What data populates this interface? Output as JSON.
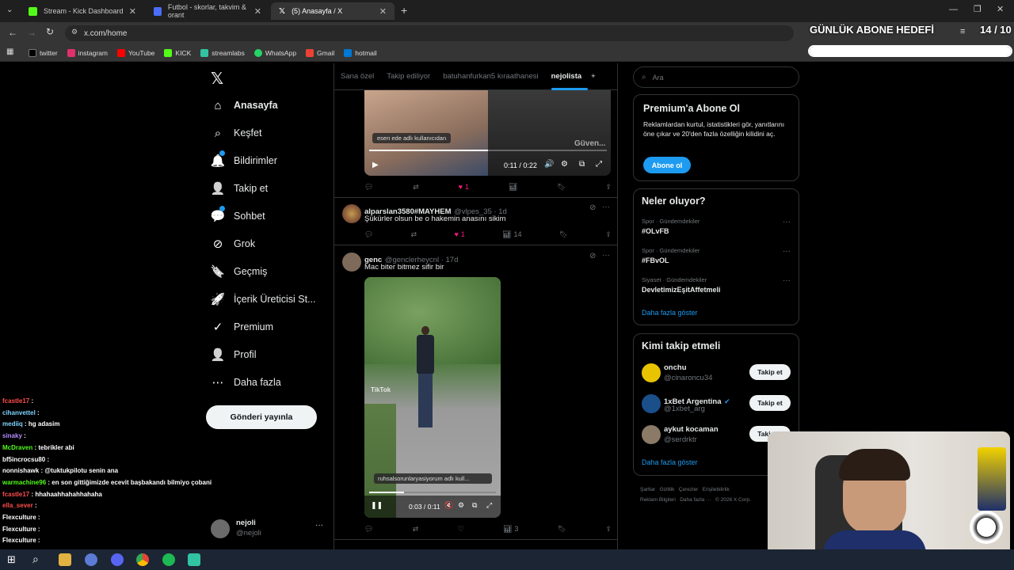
{
  "browser": {
    "tabs": [
      {
        "title": "Stream - Kick Dashboard",
        "active": false,
        "color": "#53fc18"
      },
      {
        "title": "Futbol - skorlar, takvim & orant",
        "active": false,
        "color": "#4a6cf7"
      },
      {
        "title": "(5) Anasayfa / X",
        "active": true,
        "color": "#ffffff"
      }
    ],
    "url": "x.com/home",
    "bookmarks": [
      {
        "label": "twitter",
        "color": "#000000"
      },
      {
        "label": "instagram",
        "color": "#e1306c"
      },
      {
        "label": "YouTube",
        "color": "#ff0000"
      },
      {
        "label": "KICK",
        "color": "#53fc18"
      },
      {
        "label": "streamlabs",
        "color": "#31c3a2"
      },
      {
        "label": "WhatsApp",
        "color": "#25d366"
      },
      {
        "label": "Gmail",
        "color": "#ea4335"
      },
      {
        "label": "hotmail",
        "color": "#0078d4"
      }
    ]
  },
  "overlay": {
    "goal_title": "GÜNLÜK ABONE HEDEFİ",
    "goal_count": "14 / 10",
    "goal_progress": 1.0
  },
  "nav": {
    "items": [
      {
        "label": "Anasayfa",
        "icon": "home-icon",
        "glyph": "⌂"
      },
      {
        "label": "Keşfet",
        "icon": "search-icon",
        "glyph": "⌕"
      },
      {
        "label": "Bildirimler",
        "icon": "bell-icon",
        "glyph": "🔔"
      },
      {
        "label": "Takip et",
        "icon": "follow-icon",
        "glyph": "👤"
      },
      {
        "label": "Sohbet",
        "icon": "chat-icon",
        "glyph": "💬"
      },
      {
        "label": "Grok",
        "icon": "grok-icon",
        "glyph": "⊘"
      },
      {
        "label": "Geçmiş",
        "icon": "bookmark-icon",
        "glyph": "🔖"
      },
      {
        "label": "İçerik Üreticisi St...",
        "icon": "rocket-icon",
        "glyph": "🚀"
      },
      {
        "label": "Premium",
        "icon": "premium-icon",
        "glyph": "✓"
      },
      {
        "label": "Profil",
        "icon": "profile-icon",
        "glyph": "👤"
      },
      {
        "label": "Daha fazla",
        "icon": "more-icon",
        "glyph": "⋯"
      }
    ],
    "post_button": "Gönderi yayınla",
    "account_name": "nejoli",
    "account_handle": "@nejoli"
  },
  "feed": {
    "tabs": [
      "Sana özel",
      "Takip ediliyor",
      "batuhanfurkan5 kıraathanesi",
      "nejolista"
    ],
    "active_tab": "nejolista",
    "tweet1": {
      "video_caption": "esen ede adlı kullanıcıdan",
      "video_watermark": "Güven...",
      "time": "0:11 / 0:22",
      "likes": "1"
    },
    "tweet2": {
      "name": "alparslan3580#MAYHEM",
      "handle": "@vlpes_35 · 1d",
      "text": "Şükürler olsun be o hakemin anasını sikim",
      "likes": "1",
      "views": "14"
    },
    "tweet3": {
      "name": "genc",
      "handle": "@genclerheycnl · 17d",
      "text": "Mac biter bitmez sifir bir",
      "video_tag": "TikTok",
      "video_caption": "ruhsalsorunlaryasiyorum adlı kull...",
      "time": "0:03 / 0:11",
      "views": "3"
    }
  },
  "sidebar": {
    "search_placeholder": "Ara",
    "premium": {
      "title": "Premium'a Abone Ol",
      "text": "Reklamlardan kurtul, istatistikleri gör, yanıtlarını öne çıkar ve 20'den fazla özelliğin kilidini aç.",
      "button": "Abone ol"
    },
    "trends": {
      "title": "Neler oluyor?",
      "items": [
        {
          "category": "Spor · Gündemdekiler",
          "name": "#OLvFB"
        },
        {
          "category": "Spor · Gündemdekiler",
          "name": "#FBvOL"
        },
        {
          "category": "Siyaset · Gündemdekiler",
          "name": "DevletimizEşitAffetmeli"
        }
      ],
      "more": "Daha fazla göster"
    },
    "who_to_follow": {
      "title": "Kimi takip etmeli",
      "items": [
        {
          "name": "onchu",
          "handle": "@cinaroncu34",
          "button": "Takip et",
          "color": "#e8c400"
        },
        {
          "name": "1xBet Argentina",
          "handle": "@1xbet_arg",
          "button": "Takip et",
          "color": "#1a4f8a"
        },
        {
          "name": "aykut kocaman",
          "handle": "@serdrktr",
          "button": "Takip et",
          "color": "#8a7a66"
        }
      ],
      "more": "Daha fazla göster"
    },
    "footer": [
      "Şartlar",
      "Gizlilik",
      "Çerezler",
      "Erişilebilirlik",
      "Reklam Bilgileri",
      "Daha fazla ···",
      "© 2026 X Corp."
    ]
  },
  "chat": [
    {
      "user": "fcastle17",
      "msg": ":",
      "color": "#ff4d4d"
    },
    {
      "user": "cihanvettel",
      "msg": ":",
      "color": "#7fd3ff"
    },
    {
      "user": "mediiq",
      "msg": ": hg adasim",
      "color": "#7fd3ff"
    },
    {
      "user": "sinaky",
      "msg": ":",
      "color": "#b38cff"
    },
    {
      "user": "McDraven",
      "msg": ": tebrikler abi",
      "color": "#53fc18"
    },
    {
      "user": "bf5incrocsu80",
      "msg": ":",
      "color": "#ffffff"
    },
    {
      "user": "nonnishawk",
      "msg": ": @tuktukpilotu senin ana",
      "color": "#ffffff"
    },
    {
      "user": "warmachine96",
      "msg": ": en son gittiğimizde ecevit başbakandı bilmiyo çobani",
      "color": "#53fc18"
    },
    {
      "user": "fcastle17",
      "msg": ": hhahaahhahahhahaha",
      "color": "#ff4d4d"
    },
    {
      "user": "ella_sever",
      "msg": ":",
      "color": "#ff4d4d"
    },
    {
      "user": "Flexculture",
      "msg": ":",
      "color": "#ffffff"
    },
    {
      "user": "Flexculture",
      "msg": ":",
      "color": "#ffffff"
    },
    {
      "user": "Flexculture",
      "msg": ":",
      "color": "#ffffff"
    },
    {
      "user": "Flexculture",
      "msg": ":",
      "color": "#ffffff"
    }
  ]
}
